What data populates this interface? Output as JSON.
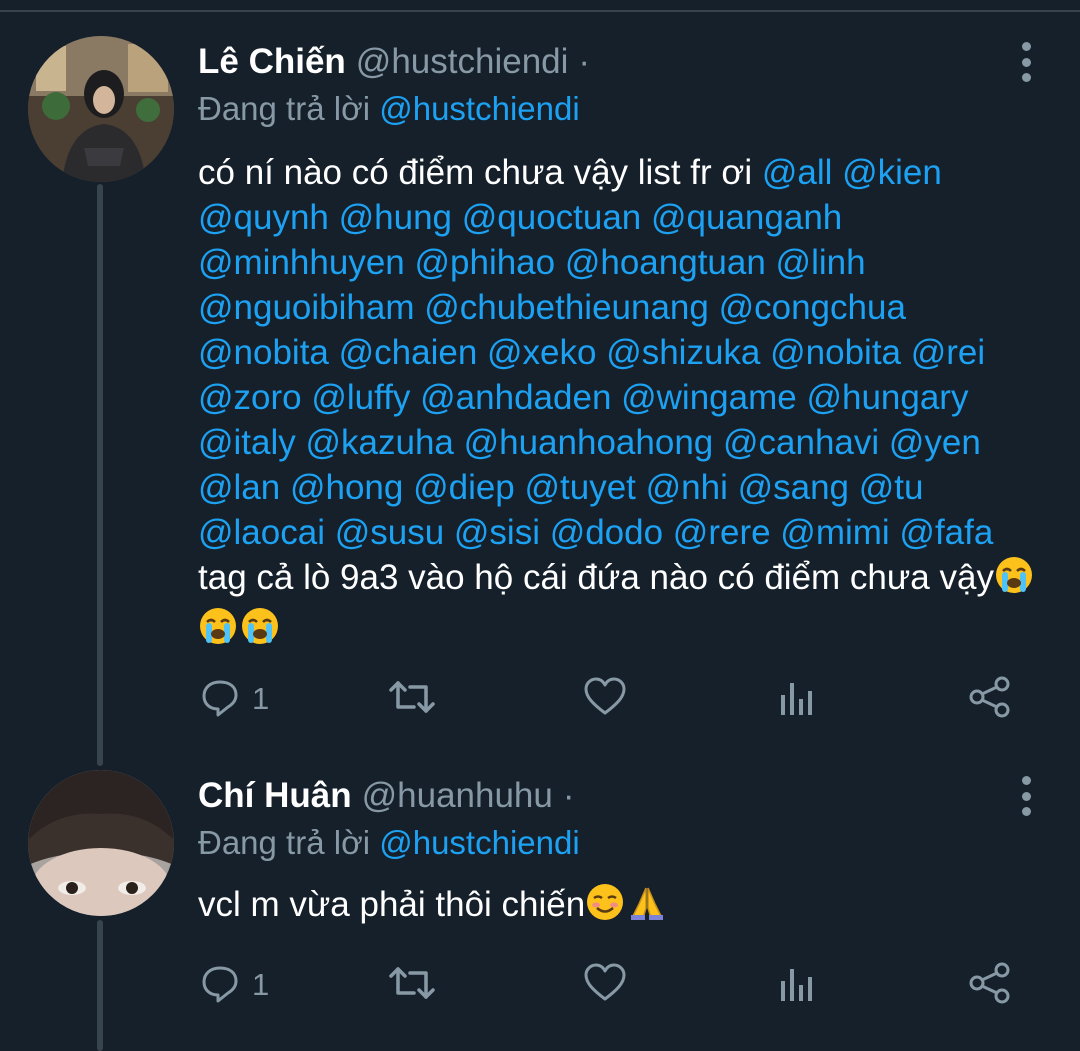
{
  "tweets": [
    {
      "display_name": "Lê Chiến",
      "handle": "@hustchiendi",
      "separator": "·",
      "reply_prefix": "Đang trả lời",
      "reply_handle": "@hustchiendi",
      "text_start": "có ní nào có điểm chưa vậy list fr ơi ",
      "mentions_block": "@all @kien @quynh @hung @quoctuan @quanganh @minhhuyen @phihao @hoangtuan @linh @nguoibiham @chubethieunang @congchua @nobita @chaien @xeko @shizuka @nobita @rei @zoro @luffy @anhdaden @wingame @hungary @italy @kazuha @huanhoahong @canhavi @yen @lan @hong @diep @tuyet @nhi @sang @tu @laocai @susu @sisi @dodo @rere @mimi @fafa",
      "text_end": " tag cả lò 9a3 vào hộ cái đứa nào có điểm chưa vậy",
      "emojis": [
        "loudly-crying-face-emoji",
        "loudly-crying-face-emoji",
        "loudly-crying-face-emoji"
      ],
      "reply_count": "1",
      "retweet_count": "",
      "like_count": ""
    },
    {
      "display_name": "Chí Huân",
      "handle": "@huanhuhu",
      "separator": "·",
      "reply_prefix": "Đang trả lời",
      "reply_handle": "@hustchiendi",
      "text_start": "vcl m vừa phải thôi chiến",
      "emojis": [
        "smiling-face-emoji",
        "folded-hands-emoji"
      ],
      "reply_count": "1",
      "retweet_count": "",
      "like_count": ""
    }
  ],
  "colors": {
    "background": "#15202b",
    "text_primary": "#ffffff",
    "text_secondary": "#8899a6",
    "link": "#1da1f2",
    "divider": "#38444d"
  },
  "icons": {
    "reply": "reply-icon",
    "retweet": "retweet-icon",
    "like": "heart-icon",
    "analytics": "analytics-icon",
    "share": "share-icon",
    "more": "more-vertical-icon"
  }
}
